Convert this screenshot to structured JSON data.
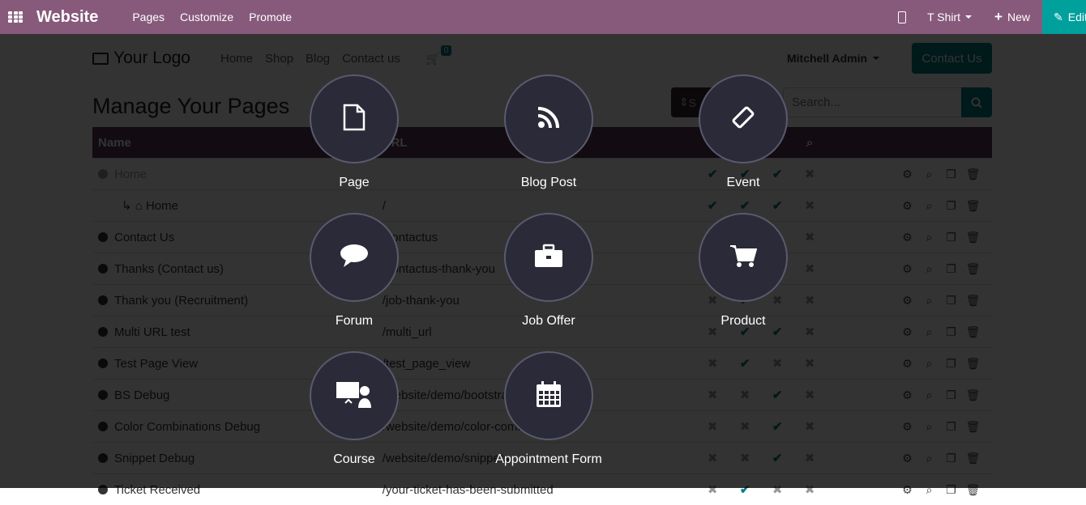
{
  "topbar": {
    "app_name": "Website",
    "menu": [
      "Pages",
      "Customize",
      "Promote"
    ],
    "website_selector": "T Shirt",
    "new_label": "New",
    "edit_label": "Edit",
    "colors": {
      "bar": "#875a7b",
      "edit": "#00a09d"
    }
  },
  "site_header": {
    "logo": "Your Logo",
    "nav": [
      "Home",
      "Shop",
      "Blog",
      "Contact us"
    ],
    "cart_count": "0",
    "user": "Mitchell Admin",
    "contact_button": "Contact Us"
  },
  "page": {
    "title": "Manage Your Pages",
    "sort_label": "S",
    "search_placeholder": "Search...",
    "columns": {
      "name": "Name",
      "url": "URL"
    },
    "rows": [
      {
        "name": "Home",
        "url": "",
        "indent": false,
        "muted": true,
        "flags": [
          "check",
          "check",
          "check",
          "cross"
        ]
      },
      {
        "name": "Home",
        "url": "/",
        "indent": true,
        "flags": [
          "check",
          "check",
          "check",
          "cross"
        ]
      },
      {
        "name": "Contact Us",
        "url": "/contactus",
        "flags": [
          "check",
          "check",
          "check",
          "cross"
        ]
      },
      {
        "name": "Thanks (Contact us)",
        "url": "/contactus-thank-you",
        "flags": [
          "cross",
          "check",
          "cross",
          "cross"
        ]
      },
      {
        "name": "Thank you (Recruitment)",
        "url": "/job-thank-you",
        "flags": [
          "cross",
          "check",
          "cross",
          "cross"
        ]
      },
      {
        "name": "Multi URL test",
        "url": "/multi_url",
        "flags": [
          "cross",
          "check",
          "check",
          "cross"
        ]
      },
      {
        "name": "Test Page View",
        "url": "/test_page_view",
        "flags": [
          "cross",
          "check",
          "cross",
          "cross"
        ]
      },
      {
        "name": "BS Debug",
        "url": "/website/demo/bootstrap",
        "flags": [
          "cross",
          "cross",
          "check",
          "cross"
        ]
      },
      {
        "name": "Color Combinations Debug",
        "url": "/website/demo/color-combinations",
        "flags": [
          "cross",
          "cross",
          "check",
          "cross"
        ]
      },
      {
        "name": "Snippet Debug",
        "url": "/website/demo/snippets",
        "flags": [
          "cross",
          "cross",
          "check",
          "cross"
        ]
      },
      {
        "name": "Ticket Received",
        "url": "/your-ticket-has-been-submitted",
        "flags": [
          "cross",
          "check",
          "cross",
          "cross"
        ]
      }
    ]
  },
  "new_content": [
    {
      "label": "Page",
      "icon": "file-icon"
    },
    {
      "label": "Blog Post",
      "icon": "rss-icon"
    },
    {
      "label": "Event",
      "icon": "ticket-icon"
    },
    {
      "label": "Forum",
      "icon": "comment-icon"
    },
    {
      "label": "Job Offer",
      "icon": "briefcase-icon"
    },
    {
      "label": "Product",
      "icon": "cart-icon"
    },
    {
      "label": "Course",
      "icon": "presentation-icon"
    },
    {
      "label": "Appointment Form",
      "icon": "calendar-icon"
    }
  ]
}
